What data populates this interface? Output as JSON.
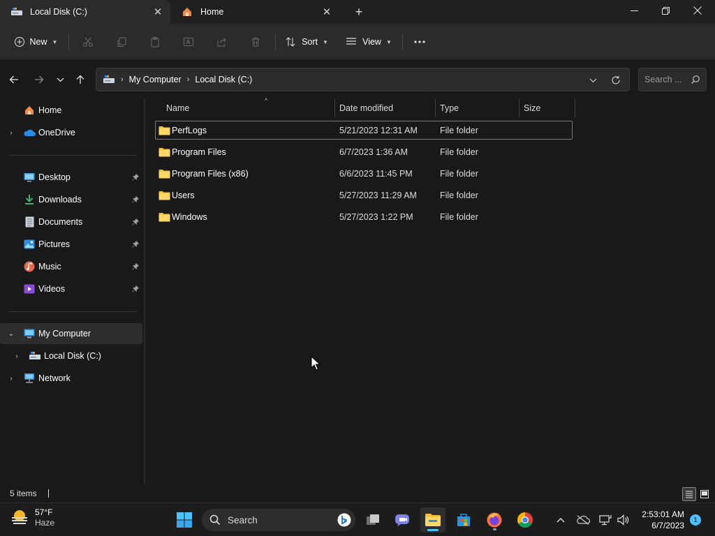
{
  "window": {
    "tabs": [
      {
        "label": "Local Disk (C:)",
        "icon": "drive-icon",
        "active": true
      },
      {
        "label": "Home",
        "icon": "home-icon",
        "active": false
      }
    ]
  },
  "toolbar": {
    "new_label": "New",
    "sort_label": "Sort",
    "view_label": "View",
    "disabled_actions": [
      "cut-icon",
      "copy-icon",
      "paste-icon",
      "rename-icon",
      "share-icon",
      "delete-icon"
    ]
  },
  "address": {
    "breadcrumbs": [
      "My Computer",
      "Local Disk (C:)"
    ],
    "search_placeholder": "Search ..."
  },
  "sidebar": {
    "home": "Home",
    "onedrive": "OneDrive",
    "quick_access": [
      {
        "label": "Desktop",
        "icon": "desktop-icon",
        "pinned": true
      },
      {
        "label": "Downloads",
        "icon": "downloads-icon",
        "pinned": true
      },
      {
        "label": "Documents",
        "icon": "documents-icon",
        "pinned": true
      },
      {
        "label": "Pictures",
        "icon": "pictures-icon",
        "pinned": true
      },
      {
        "label": "Music",
        "icon": "music-icon",
        "pinned": true
      },
      {
        "label": "Videos",
        "icon": "videos-icon",
        "pinned": true
      }
    ],
    "my_computer": "My Computer",
    "local_disk": "Local Disk (C:)",
    "network": "Network"
  },
  "files": {
    "columns": [
      "Name",
      "Date modified",
      "Type",
      "Size"
    ],
    "rows": [
      {
        "name": "PerfLogs",
        "date": "5/21/2023 12:31 AM",
        "type": "File folder",
        "size": ""
      },
      {
        "name": "Program Files",
        "date": "6/7/2023 1:36 AM",
        "type": "File folder",
        "size": ""
      },
      {
        "name": "Program Files (x86)",
        "date": "6/6/2023 11:45 PM",
        "type": "File folder",
        "size": ""
      },
      {
        "name": "Users",
        "date": "5/27/2023 11:29 AM",
        "type": "File folder",
        "size": ""
      },
      {
        "name": "Windows",
        "date": "5/27/2023 1:22 PM",
        "type": "File folder",
        "size": ""
      }
    ]
  },
  "status": {
    "item_count": "5 items"
  },
  "taskbar": {
    "weather_temp": "57°F",
    "weather_condition": "Haze",
    "search_label": "Search",
    "time": "2:53:01 AM",
    "date": "6/7/2023",
    "notification_count": "1"
  },
  "colors": {
    "accent": "#4cc2ff",
    "folder": "#f3c340",
    "window_bg": "#191919",
    "toolbar_bg": "#2b2b2b"
  }
}
